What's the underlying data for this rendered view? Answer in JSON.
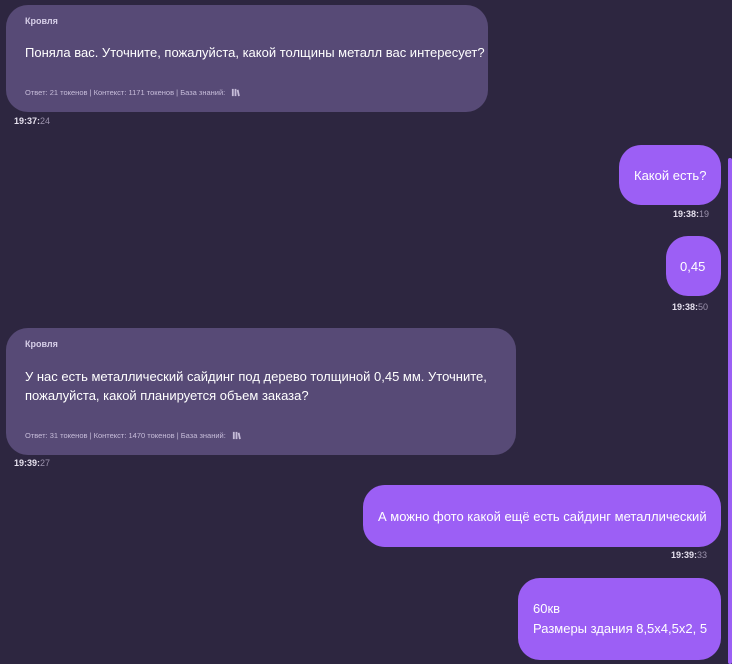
{
  "messages": [
    {
      "sender": "Кровля",
      "text": "Поняла вас. Уточните, пожалуйста, какой толщины металл вас интересует?",
      "meta": "Ответ: 21 токенов | Контекст: 1171 токенов | База знаний:",
      "time_hm": "19:37:",
      "time_s": "24"
    },
    {
      "text": "Какой есть?",
      "time_hm": "19:38:",
      "time_s": "19"
    },
    {
      "text": "0,45",
      "time_hm": "19:38:",
      "time_s": "50"
    },
    {
      "sender": "Кровля",
      "text_line1": "У нас есть металлический сайдинг под дерево толщиной 0,45 мм. Уточните,",
      "text_line2": "пожалуйста, какой планируется объем заказа?",
      "meta": "Ответ: 31 токенов | Контекст: 1470 токенов | База знаний:",
      "time_hm": "19:39:",
      "time_s": "27"
    },
    {
      "text": "А можно фото какой ещё есть сайдинг металлический",
      "time_hm": "19:39:",
      "time_s": "33"
    },
    {
      "text_line1": "60кв",
      "text_line2": "Размеры здания 8,5х4,5х2, 5"
    }
  ],
  "colors": {
    "background": "#2d2640",
    "bot_bubble": "#574a76",
    "user_bubble": "#9c5ff5"
  },
  "icons": {
    "knowledge_base": "library-books-icon"
  }
}
